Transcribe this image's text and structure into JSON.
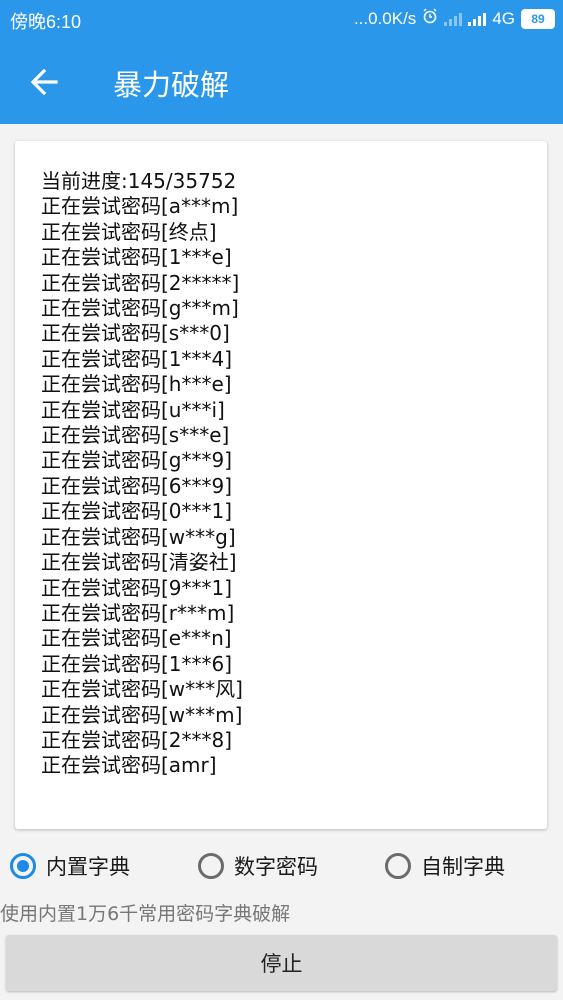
{
  "status_bar": {
    "time": "傍晚6:10",
    "net_speed": "...0.0K/s",
    "network": "4G",
    "battery": "89",
    "icons": [
      "alarm-icon",
      "signal-weak-icon",
      "signal-icon",
      "battery-icon"
    ]
  },
  "app_bar": {
    "title": "暴力破解",
    "back_icon": "arrow-left-icon"
  },
  "log": {
    "lines": [
      "当前进度:145/35752",
      "正在尝试密码[a***m]",
      "正在尝试密码[终点]",
      "正在尝试密码[1***e]",
      "正在尝试密码[2*****]",
      "正在尝试密码[g***m]",
      "正在尝试密码[s***0]",
      "正在尝试密码[1***4]",
      "正在尝试密码[h***e]",
      "正在尝试密码[u***i]",
      "正在尝试密码[s***e]",
      "正在尝试密码[g***9]",
      "正在尝试密码[6***9]",
      "正在尝试密码[0***1]",
      "正在尝试密码[w***g]",
      "正在尝试密码[清姿社]",
      "正在尝试密码[9***1]",
      "正在尝试密码[r***m]",
      "正在尝试密码[e***n]",
      "正在尝试密码[1***6]",
      "正在尝试密码[w***风]",
      "正在尝试密码[w***m]",
      "正在尝试密码[2***8]",
      "正在尝试密码[amr]"
    ]
  },
  "options": {
    "builtin_dict": "内置字典",
    "numeric_password": "数字密码",
    "custom_dict": "自制字典",
    "selected": "内置字典"
  },
  "hint": "使用内置1万6千常用密码字典破解",
  "stop_button": "停止",
  "colors": {
    "primary": "#2a97ea",
    "accent": "#1e8ae6",
    "button": "#d9d9d9"
  }
}
